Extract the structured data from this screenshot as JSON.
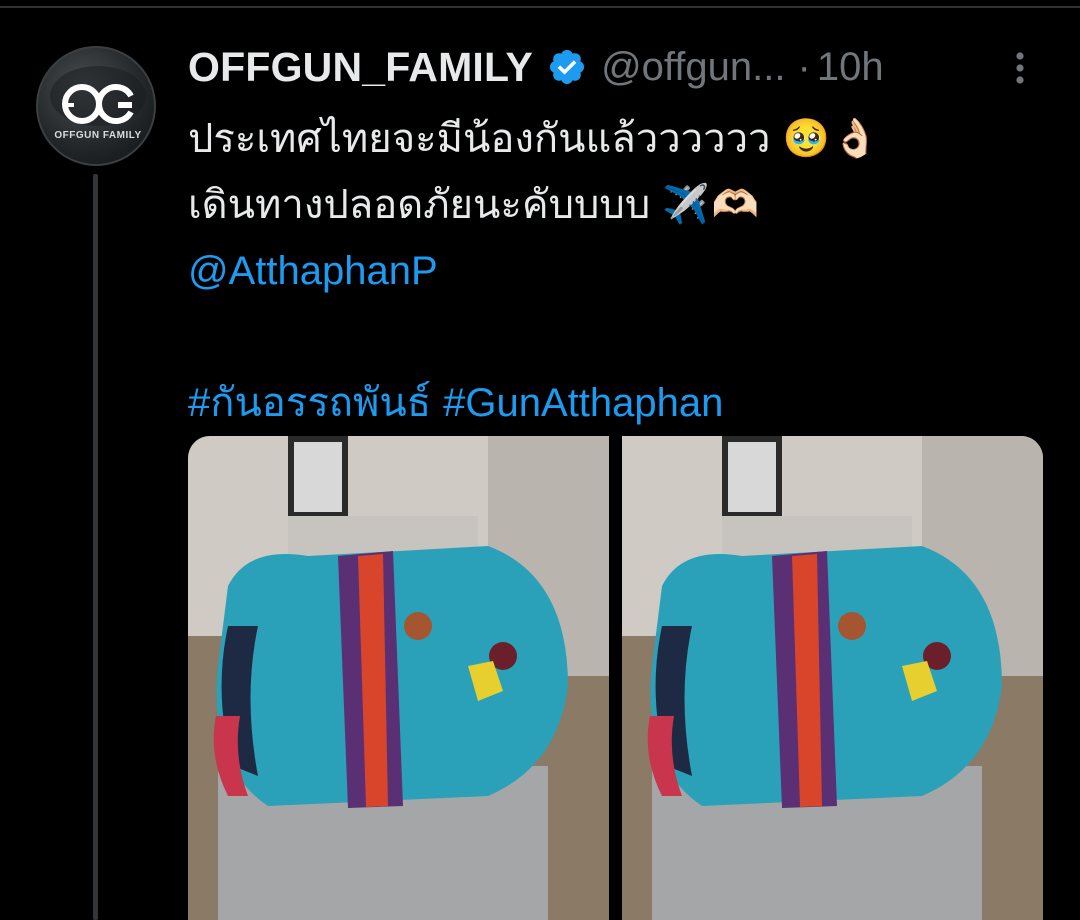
{
  "tweet": {
    "display_name": "OFFGUN_FAMILY",
    "handle": "@offgun...",
    "separator": "·",
    "timestamp": "10h",
    "avatar_caption": "OFFGUN FAMILY",
    "text_line_1": "ประเทศไทยจะมีน้องกันแล้วววววว",
    "text_line_1_emojis": [
      "🥹",
      "👌🏻"
    ],
    "text_line_2": "เดินทางปลอดภัยนะคับบบบ",
    "text_line_2_emojis": [
      "✈️",
      "🫶🏻"
    ],
    "mention": "@AtthaphanP",
    "hashtags": [
      "#กันอรรถพันธ์",
      "#GunAtthaphan"
    ],
    "media_count": 2
  },
  "icons": {
    "verified": "verified-badge-icon",
    "more": "more-options-icon"
  },
  "colors": {
    "background": "#000000",
    "text": "#e7e9ea",
    "secondary": "#71767b",
    "link": "#1d9bf0",
    "verified": "#1d9bf0",
    "thread_line": "#333639"
  }
}
